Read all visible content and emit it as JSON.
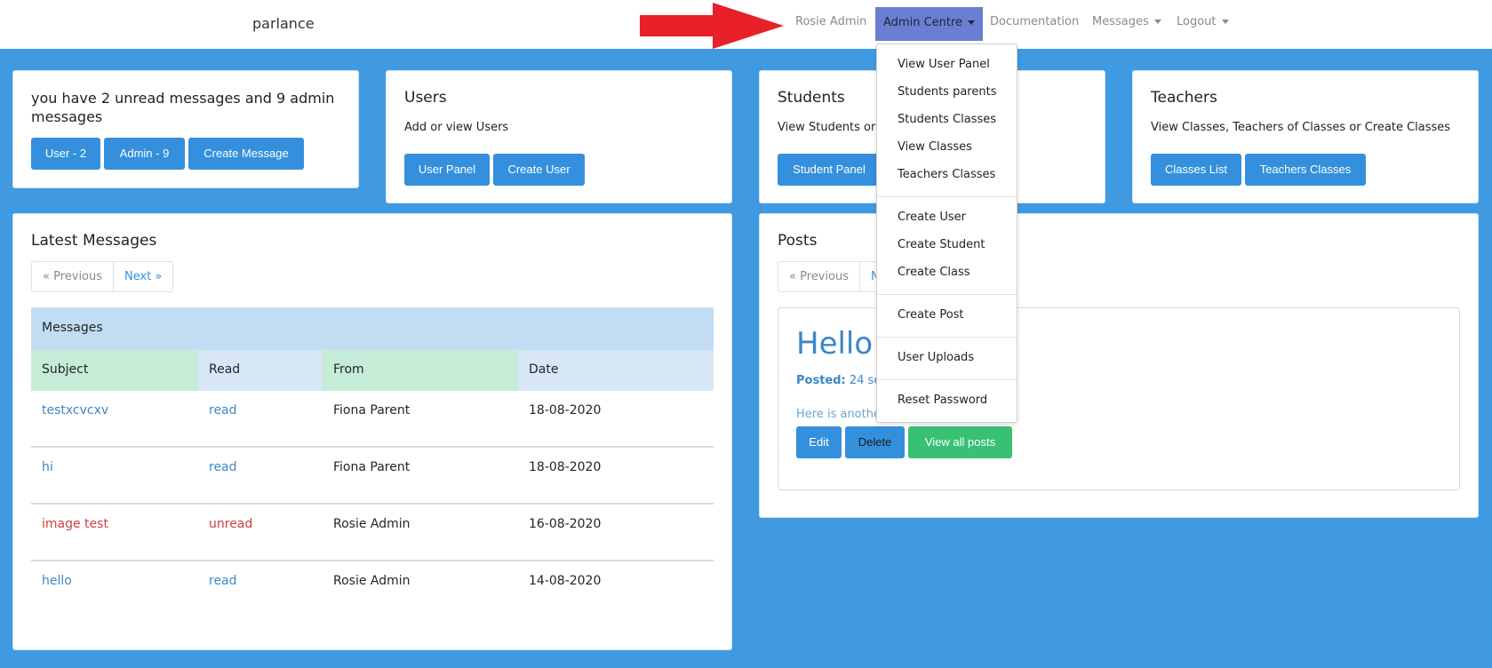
{
  "brand": "parlance",
  "nav": {
    "user": "Rosie Admin",
    "admin_centre": "Admin Centre",
    "documentation": "Documentation",
    "messages": "Messages",
    "logout": "Logout"
  },
  "dropdown": {
    "items": [
      "View User Panel",
      "Students parents",
      "Students Classes",
      "View Classes",
      "Teachers Classes",
      "Create User",
      "Create Student",
      "Create Class",
      "Create Post",
      "User Uploads",
      "Reset Password"
    ]
  },
  "unread_card": {
    "text": "you have 2 unread messages and 9 admin messages",
    "user_btn": "User - 2",
    "admin_btn": "Admin - 9",
    "create_btn": "Create Message"
  },
  "users_card": {
    "title": "Users",
    "text": "Add or view Users",
    "btn1": "User Panel",
    "btn2": "Create User"
  },
  "students_card": {
    "title": "Students",
    "text": "View Students or",
    "btn1": "Student Panel"
  },
  "teachers_card": {
    "title": "Teachers",
    "text": "View Classes, Teachers of Classes or Create Classes",
    "btn1": "Classes List",
    "btn2": "Teachers Classes"
  },
  "messages_card": {
    "title": "Latest Messages",
    "prev": "« Previous",
    "next": "Next »",
    "table_title": "Messages",
    "headers": [
      "Subject",
      "Read",
      "From",
      "Date"
    ],
    "rows": [
      {
        "subject": "testxcvcxv",
        "read": "read",
        "from": "Fiona Parent",
        "date": "18-08-2020"
      },
      {
        "subject": "hi",
        "read": "read",
        "from": "Fiona Parent",
        "date": "18-08-2020"
      },
      {
        "subject": "image test",
        "read": "unread",
        "from": "Rosie Admin",
        "date": "16-08-2020"
      },
      {
        "subject": "hello",
        "read": "read",
        "from": "Rosie Admin",
        "date": "14-08-2020"
      }
    ]
  },
  "posts_card": {
    "title": "Posts",
    "prev": "« Previous",
    "next": "N",
    "post_title": "Hello",
    "posted_label": "Posted:",
    "posted_time": "24 sec",
    "excerpt": "Here is anothe",
    "edit": "Edit",
    "delete": "Delete",
    "view_all": "View all posts"
  },
  "colors": {
    "page_bg": "#3f9ae2",
    "primary": "#3490dc",
    "success": "#38c172",
    "nav_active": "#6a7fd3",
    "arrow": "#e8202a"
  }
}
